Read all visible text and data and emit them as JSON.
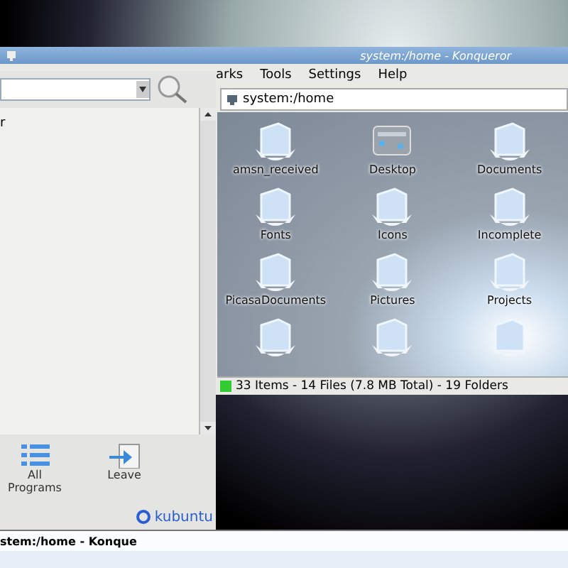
{
  "window": {
    "title": "system:/home - Konqueror",
    "menu": [
      "arks",
      "Tools",
      "Settings",
      "Help"
    ],
    "location": "system:/home",
    "items": [
      {
        "name": "amsn_received",
        "kind": "folder"
      },
      {
        "name": "Desktop",
        "kind": "desktop"
      },
      {
        "name": "Documents",
        "kind": "folder"
      },
      {
        "name": "Fonts",
        "kind": "folder"
      },
      {
        "name": "Icons",
        "kind": "folder"
      },
      {
        "name": "Incomplete",
        "kind": "folder"
      },
      {
        "name": "PicasaDocuments",
        "kind": "folder"
      },
      {
        "name": "Pictures",
        "kind": "folder"
      },
      {
        "name": "Projects",
        "kind": "folder"
      },
      {
        "kind": "folder"
      },
      {
        "kind": "folder"
      },
      {
        "kind": "folder"
      }
    ],
    "status": "33 Items - 14 Files (7.8 MB Total) - 19 Folders"
  },
  "launcher": {
    "list_items": [
      "r"
    ],
    "tabs": [
      {
        "label": "All Programs",
        "kind": "list"
      },
      {
        "label": "Leave",
        "kind": "leave"
      }
    ],
    "brand": "kubuntu"
  },
  "taskbar": {
    "tasks": [
      "stem:/home - Konque"
    ]
  }
}
